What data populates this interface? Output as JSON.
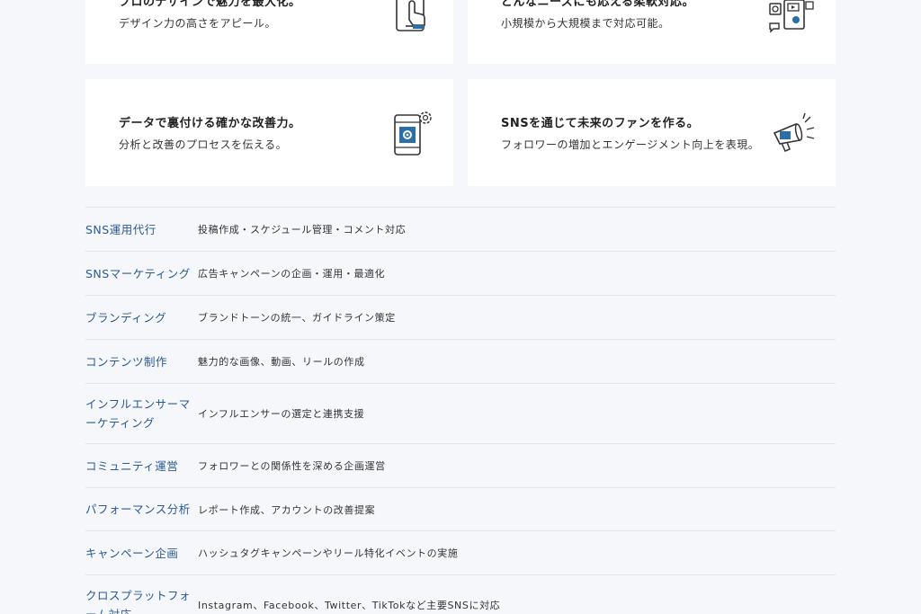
{
  "cards": [
    {
      "title": "プロのデザインで魅力を最大化。",
      "sub": "デザイン力の高さをアピール。",
      "icon": "smartphone-touch-icon"
    },
    {
      "title": "どんなニーズにも応える柔軟対応。",
      "sub": "小規模から大規模まで対応可能。",
      "icon": "multimedia-devices-icon"
    },
    {
      "title": "データで裏付ける確かな改善力。",
      "sub": "分析と改善のプロセスを伝える。",
      "icon": "smartphone-gear-icon"
    },
    {
      "title": "SNSを通じて未来のファンを作る。",
      "sub": "フォロワーの増加とエンゲージメント向上を表現。",
      "icon": "megaphone-icon"
    }
  ],
  "services": [
    {
      "name": "SNS運用代行",
      "desc": "投稿作成・スケジュール管理・コメント対応"
    },
    {
      "name": "SNSマーケティング",
      "desc": "広告キャンペーンの企画・運用・最適化"
    },
    {
      "name": "ブランディング",
      "desc": "ブランドトーンの統一、ガイドライン策定"
    },
    {
      "name": "コンテンツ制作",
      "desc": "魅力的な画像、動画、リールの作成"
    },
    {
      "name": "インフルエンサーマーケティング",
      "desc": "インフルエンサーの選定と連携支援"
    },
    {
      "name": "コミュニティ運営",
      "desc": "フォロワーとの関係性を深める企画運営"
    },
    {
      "name": "パフォーマンス分析",
      "desc": "レポート作成、アカウントの改善提案"
    },
    {
      "name": "キャンペーン企画",
      "desc": "ハッシュタグキャンペーンやリール特化イベントの実施"
    },
    {
      "name": "クロスプラットフォーム対応",
      "desc": "Instagram、Facebook、Twitter、TikTokなど主要SNSに対応"
    }
  ],
  "colors": {
    "accent_blue": "#2a5a93",
    "icon_stroke": "#333333",
    "icon_accent": "#2b6fa8",
    "background": "#f5f7fa",
    "card": "#ffffff",
    "divider": "#e2e6ea"
  }
}
